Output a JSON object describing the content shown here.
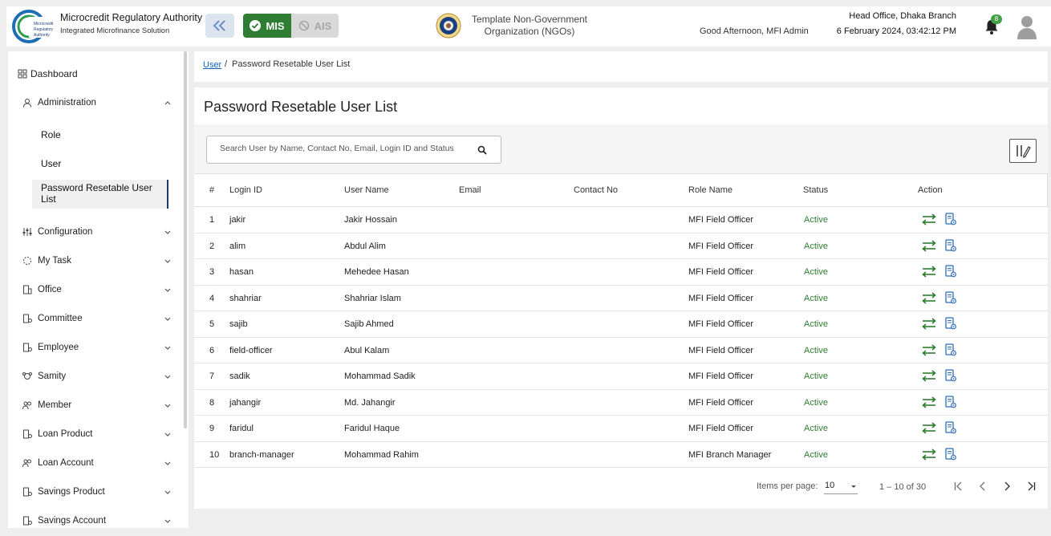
{
  "header": {
    "brand_title": "Microcredit Regulatory Authority",
    "brand_subtitle": "Integrated Microfinance Solution",
    "logo_text": "Microcredit Regulatory Authority",
    "mode_mis": "MIS",
    "mode_ais": "AIS",
    "org_name": "Template Non-Government Organization (NGOs)",
    "greeting": "Good Afternoon, MFI Admin",
    "branch": "Head Office, Dhaka Branch",
    "datetime": "6 February 2024, 03:42:12 PM",
    "notification_count": "8"
  },
  "sidebar": {
    "dashboard": "Dashboard",
    "administration": "Administration",
    "admin_children": [
      "Role",
      "User",
      "Password Resetable User List"
    ],
    "items": [
      "Configuration",
      "My Task",
      "Office",
      "Committee",
      "Employee",
      "Samity",
      "Member",
      "Loan Product",
      "Loan Account",
      "Savings Product",
      "Savings Account"
    ]
  },
  "breadcrumb": {
    "parent": "User",
    "separator": "/",
    "current": "Password Resetable User List"
  },
  "page": {
    "title": "Password Resetable User List",
    "search_placeholder": "Search User by Name, Contact No, Email, Login ID and Status"
  },
  "table": {
    "headers": [
      "#",
      "Login ID",
      "User Name",
      "Email",
      "Contact No",
      "Role Name",
      "Status",
      "Action"
    ],
    "rows": [
      {
        "n": "1",
        "login": "jakir",
        "name": "Jakir Hossain",
        "email": "",
        "contact": "",
        "role": "MFI Field Officer",
        "status": "Active"
      },
      {
        "n": "2",
        "login": "alim",
        "name": "Abdul Alim",
        "email": "",
        "contact": "",
        "role": "MFI Field Officer",
        "status": "Active"
      },
      {
        "n": "3",
        "login": "hasan",
        "name": "Mehedee Hasan",
        "email": "",
        "contact": "",
        "role": "MFI Field Officer",
        "status": "Active"
      },
      {
        "n": "4",
        "login": "shahriar",
        "name": "Shahriar Islam",
        "email": "",
        "contact": "",
        "role": "MFI Field Officer",
        "status": "Active"
      },
      {
        "n": "5",
        "login": "sajib",
        "name": "Sajib Ahmed",
        "email": "",
        "contact": "",
        "role": "MFI Field Officer",
        "status": "Active"
      },
      {
        "n": "6",
        "login": "field-officer",
        "name": "Abul Kalam",
        "email": "",
        "contact": "",
        "role": "MFI Field Officer",
        "status": "Active"
      },
      {
        "n": "7",
        "login": "sadik",
        "name": "Mohammad Sadik",
        "email": "",
        "contact": "",
        "role": "MFI Field Officer",
        "status": "Active"
      },
      {
        "n": "8",
        "login": "jahangir",
        "name": "Md. Jahangir",
        "email": "",
        "contact": "",
        "role": "MFI Field Officer",
        "status": "Active"
      },
      {
        "n": "9",
        "login": "faridul",
        "name": "Faridul Haque",
        "email": "",
        "contact": "",
        "role": "MFI Field Officer",
        "status": "Active"
      },
      {
        "n": "10",
        "login": "branch-manager",
        "name": "Mohammad Rahim",
        "email": "",
        "contact": "",
        "role": "MFI Branch Manager",
        "status": "Active"
      }
    ]
  },
  "paginator": {
    "label": "Items per page:",
    "page_size": "10",
    "range": "1 – 10 of 30"
  },
  "colors": {
    "accent_green": "#2e7d32",
    "link_blue": "#1565c0",
    "nav_active": "#1e3a6e"
  },
  "icons": [
    "collapse-icon",
    "check-circle-icon",
    "block-icon",
    "bell-icon",
    "user-avatar-icon",
    "search-icon",
    "column-toggle-icon",
    "reset-password-icon",
    "user-details-icon",
    "first-page-icon",
    "prev-page-icon",
    "next-page-icon",
    "last-page-icon"
  ]
}
